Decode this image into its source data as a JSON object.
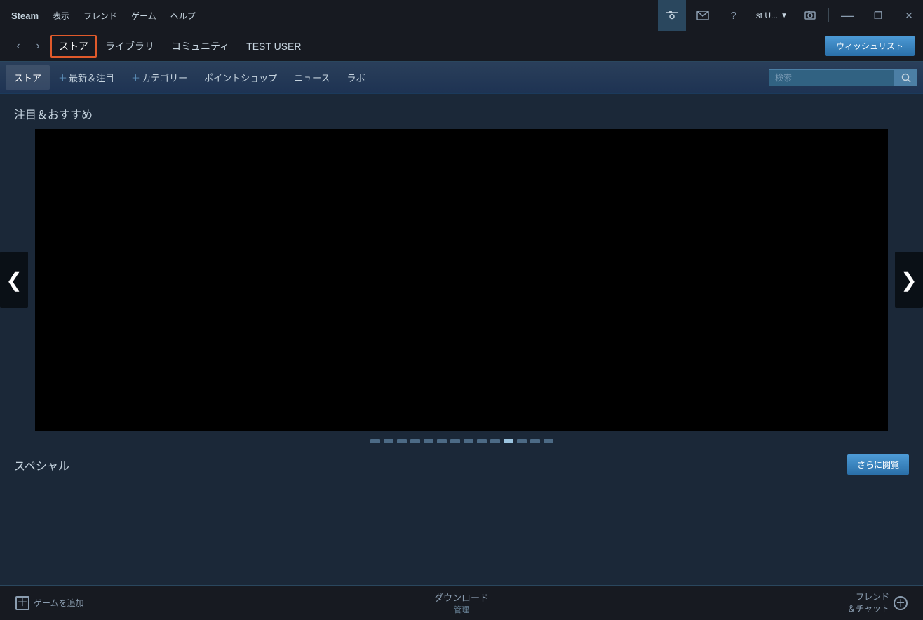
{
  "titlebar": {
    "steam_label": "Steam",
    "menu": {
      "display": "表示",
      "friends": "フレンド",
      "games": "ゲーム",
      "help": "ヘルプ"
    },
    "right": {
      "camera_icon": "📷",
      "mail_icon": "✉",
      "help_icon": "?",
      "user_label": "st U...",
      "screenshot_icon": "🖼",
      "minimize_label": "—",
      "restore_label": "❐",
      "close_label": "✕"
    }
  },
  "navbar": {
    "back_arrow": "‹",
    "forward_arrow": "›",
    "tabs": [
      {
        "label": "ストア",
        "active": true
      },
      {
        "label": "ライブラリ",
        "active": false
      },
      {
        "label": "コミュニティ",
        "active": false
      }
    ],
    "username": "TEST USER",
    "wishlist_btn": "ウィッシュリスト"
  },
  "subnav": {
    "items": [
      {
        "label": "ストア",
        "active": true,
        "plus": false
      },
      {
        "label": "最新＆注目",
        "active": false,
        "plus": true
      },
      {
        "label": "カテゴリー",
        "active": false,
        "plus": true
      },
      {
        "label": "ポイントショップ",
        "active": false,
        "plus": false
      },
      {
        "label": "ニュース",
        "active": false,
        "plus": false
      },
      {
        "label": "ラボ",
        "active": false,
        "plus": false
      }
    ],
    "search_placeholder": "検索"
  },
  "main": {
    "featured_title": "注目＆おすすめ",
    "carousel_dots_count": 14,
    "carousel_active_dot": 10,
    "prev_arrow": "❮",
    "next_arrow": "❯",
    "special_section_title": "スペシャル",
    "more_btn": "さらに閲覧"
  },
  "taskbar": {
    "add_game_label": "ゲームを追加",
    "download_label": "ダウンロード",
    "download_sublabel": "管理",
    "friend_chat_label": "フレンド\n＆チャット"
  }
}
